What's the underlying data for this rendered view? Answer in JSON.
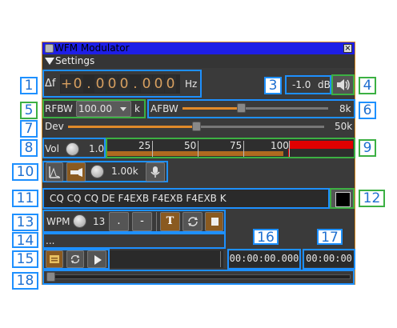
{
  "window": {
    "title": "WFM Modulator",
    "settings_label": "Settings"
  },
  "freq": {
    "delta_label": "Δf",
    "sign": "+",
    "digits": [
      "0",
      ".",
      "0",
      "0",
      "0",
      ".",
      "0",
      "0",
      "0"
    ],
    "unit": "Hz"
  },
  "level": {
    "value": "-1.0",
    "unit": "dB"
  },
  "rfbw": {
    "label": "RFBW",
    "value": "100.00",
    "unit": "k"
  },
  "afbw": {
    "label": "AFBW",
    "value": "8k",
    "fraction": 0.4
  },
  "dev": {
    "label": "Dev",
    "value": "50k",
    "fraction": 0.5
  },
  "vol": {
    "label": "Vol",
    "value": "1.0",
    "scale": [
      "25",
      "50",
      "75",
      "100"
    ]
  },
  "tone": {
    "value": "1.00k"
  },
  "morse": {
    "text": "CQ CQ CQ DE F4EXB F4EXB F4EXB K"
  },
  "cw": {
    "wpm_label": "WPM",
    "wpm_value": "13",
    "dot": ".",
    "dash": "-",
    "text_btn": "T"
  },
  "keyer_text": "...",
  "file": {
    "time1": "00:00:00.000",
    "time2": "00:00:00"
  },
  "callouts": [
    "1",
    "2",
    "3",
    "4",
    "5",
    "6",
    "7",
    "8",
    "9",
    "10",
    "11",
    "12",
    "13",
    "14",
    "15",
    "16",
    "17",
    "18"
  ],
  "colors": {
    "accent": "#e08a2a",
    "title_bar": "#1e1ee6",
    "callout_blue": "#1e90ff",
    "callout_green": "#3cb043"
  }
}
